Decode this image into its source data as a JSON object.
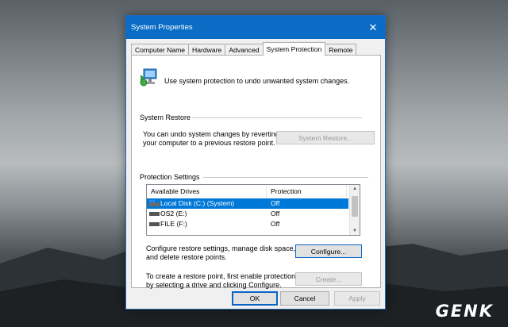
{
  "window": {
    "title": "System Properties"
  },
  "tabs": [
    {
      "label": "Computer Name"
    },
    {
      "label": "Hardware"
    },
    {
      "label": "Advanced"
    },
    {
      "label": "System Protection"
    },
    {
      "label": "Remote"
    }
  ],
  "intro_text": "Use system protection to undo unwanted system changes.",
  "restore": {
    "group_label": "System Restore",
    "description_line1": "You can undo system changes by reverting",
    "description_line2": "your computer to a previous restore point.",
    "button": "System Restore..."
  },
  "protection": {
    "group_label": "Protection Settings",
    "columns": [
      "Available Drives",
      "Protection"
    ],
    "drives": [
      {
        "name": "Local Disk (C:) (System)",
        "protection": "Off",
        "selected": true,
        "icon": "system-drive-icon"
      },
      {
        "name": "OS2 (E:)",
        "protection": "Off",
        "selected": false,
        "icon": "drive-icon"
      },
      {
        "name": "FILE (F:)",
        "protection": "Off",
        "selected": false,
        "icon": "drive-icon"
      }
    ],
    "configure_text_line1": "Configure restore settings, manage disk space,",
    "configure_text_line2": "and delete restore points.",
    "configure_button": "Configure...",
    "create_text_line1": "To create a restore point, first enable protection",
    "create_text_line2": "by selecting a drive and clicking Configure.",
    "create_button": "Create..."
  },
  "footer": {
    "ok": "OK",
    "cancel": "Cancel",
    "apply": "Apply"
  },
  "watermark": "GENK",
  "colors": {
    "accent": "#0b6cc6",
    "selection": "#0078d7"
  }
}
